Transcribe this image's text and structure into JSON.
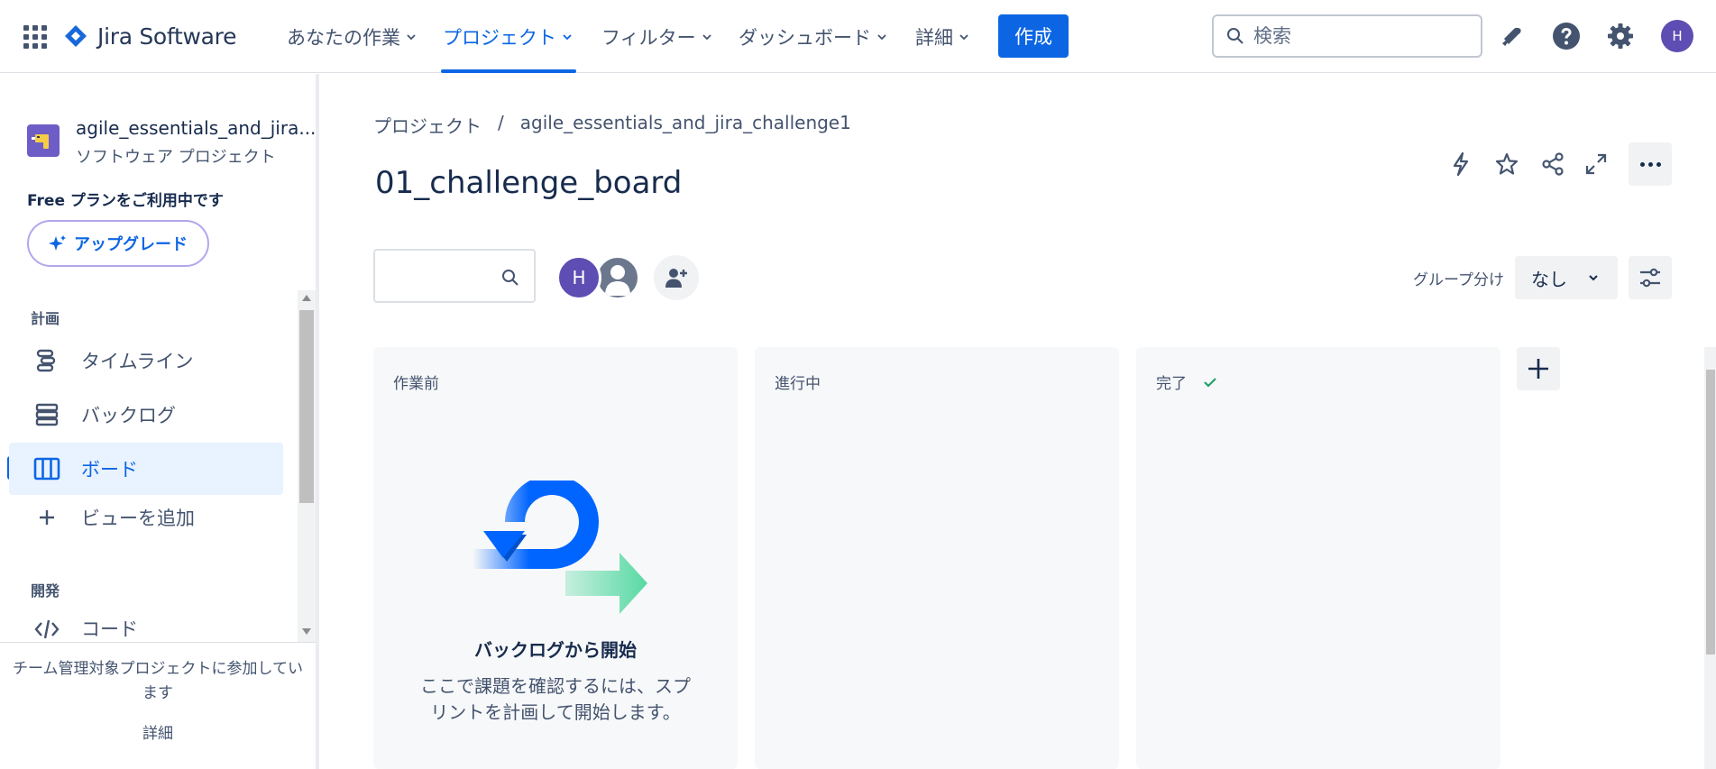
{
  "topnav": {
    "product": "Jira Software",
    "items": [
      {
        "label": "あなたの作業"
      },
      {
        "label": "プロジェクト"
      },
      {
        "label": "フィルター"
      },
      {
        "label": "ダッシュボード"
      },
      {
        "label": "詳細"
      }
    ],
    "create_label": "作成",
    "search_placeholder": "検索",
    "avatar_initial": "H"
  },
  "sidebar": {
    "project_name": "agile_essentials_and_jira...",
    "project_type": "ソフトウェア プロジェクト",
    "plan_text": "Free プランをご利用中です",
    "upgrade_label": "アップグレード",
    "sections": [
      {
        "label": "計画"
      },
      {
        "label": "開発"
      }
    ],
    "items": [
      {
        "label": "タイムライン",
        "icon": "timeline-icon"
      },
      {
        "label": "バックログ",
        "icon": "backlog-icon"
      },
      {
        "label": "ボード",
        "icon": "board-icon"
      },
      {
        "label": "ビューを追加",
        "icon": "plus-icon"
      },
      {
        "label": "コード",
        "icon": "code-icon"
      }
    ],
    "footer_text": "チーム管理対象プロジェクトに参加しています",
    "footer_link": "詳細"
  },
  "main": {
    "breadcrumb": [
      "プロジェクト",
      "/",
      "agile_essentials_and_jira_challenge1"
    ],
    "title": "01_challenge_board",
    "avatar_initial": "H",
    "group_label": "グループ分け",
    "group_value": "なし",
    "columns": [
      {
        "title": "作業前",
        "done": false
      },
      {
        "title": "進行中",
        "done": false
      },
      {
        "title": "完了",
        "done": true
      }
    ],
    "empty_title": "バックログから開始",
    "empty_desc": "ここで課題を確認するには、スプリントを計画して開始します。"
  },
  "colors": {
    "accent": "#0c66e4",
    "avatar": "#5e4db2",
    "done_check": "#22a06b",
    "column_bg": "#f7f8f9"
  }
}
